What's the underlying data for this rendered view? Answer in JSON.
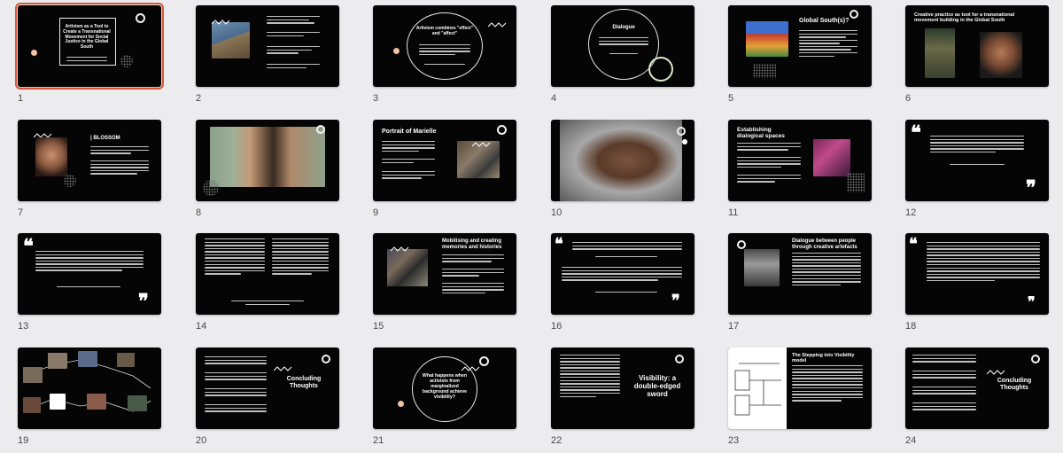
{
  "slides": [
    {
      "number": "1",
      "title": "Artivism as a Tool to Create a Transnational Movement for Social Justice in the Global South"
    },
    {
      "number": "2",
      "title": ""
    },
    {
      "number": "3",
      "title": "Artivism combines \"effect\" and \"affect\""
    },
    {
      "number": "4",
      "title": "Dialogue"
    },
    {
      "number": "5",
      "title": "Global South(s)?"
    },
    {
      "number": "6",
      "title": "Creative practice as tool for a transnational movement building in the Global South"
    },
    {
      "number": "7",
      "title": "| BLOSSOM"
    },
    {
      "number": "8",
      "title": ""
    },
    {
      "number": "9",
      "title": "Portrait of Marielle"
    },
    {
      "number": "10",
      "title": ""
    },
    {
      "number": "11",
      "title": "Establishing dialogical spaces"
    },
    {
      "number": "12",
      "title": ""
    },
    {
      "number": "13",
      "title": ""
    },
    {
      "number": "14",
      "title": ""
    },
    {
      "number": "15",
      "title": "Mobilising and creating memories and histories"
    },
    {
      "number": "16",
      "title": ""
    },
    {
      "number": "17",
      "title": "Dialogue between people through creative artefacts"
    },
    {
      "number": "18",
      "title": ""
    },
    {
      "number": "19",
      "title": ""
    },
    {
      "number": "20",
      "title": "Concluding Thoughts"
    },
    {
      "number": "21",
      "title": "What happens when activists from marginalized background achieve visibility?"
    },
    {
      "number": "22",
      "title": "Visibility: a double-edged sword"
    },
    {
      "number": "23",
      "title": "The Stepping into Visibility model"
    },
    {
      "number": "24",
      "title": "Concluding Thoughts"
    }
  ],
  "colors": {
    "selection": "#d9573a",
    "slide_bg": "#050505",
    "accent": "#f3c2a0"
  }
}
